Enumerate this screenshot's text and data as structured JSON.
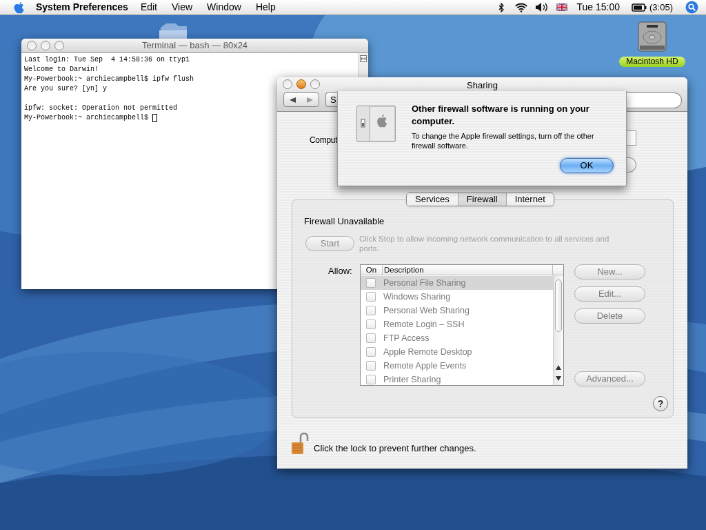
{
  "menu_bar": {
    "app": "System Preferences",
    "menus": [
      "Edit",
      "View",
      "Window",
      "Help"
    ],
    "clock": "Tue 15:00",
    "battery": "(3:05)"
  },
  "desktop": {
    "icons": [
      {
        "label": "Macintosh HD"
      }
    ]
  },
  "terminal": {
    "title": "Terminal — bash — 80x24",
    "blocks": [
      [
        "Last login: Tue Sep  4 14:58:36 on ttyp1",
        "Welcome to Darwin!",
        "My-Powerbook:~ archiecampbell$ ipfw flush",
        "Are you sure? [yn] y"
      ],
      [
        "ipfw: socket: Operation not permitted",
        "My-Powerbook:~ archiecampbell$ "
      ]
    ]
  },
  "sharing": {
    "title": "Sharing",
    "show_all": "S",
    "computer_label": "Comput",
    "tabs": [
      {
        "label": "Services",
        "selected": false
      },
      {
        "label": "Firewall",
        "selected": true
      },
      {
        "label": "Internet",
        "selected": false
      }
    ],
    "status": "Firewall Unavailable",
    "start_button": "Start",
    "start_help": "Click Stop to allow incoming network communication to all services and ports.",
    "allow_label": "Allow:",
    "columns": [
      "On",
      "Description"
    ],
    "rows": [
      {
        "description": "Personal File Sharing",
        "checked": false,
        "selected": true
      },
      {
        "description": "Windows Sharing",
        "checked": false,
        "selected": false
      },
      {
        "description": "Personal Web Sharing",
        "checked": false,
        "selected": false
      },
      {
        "description": "Remote Login – SSH",
        "checked": false,
        "selected": false
      },
      {
        "description": "FTP Access",
        "checked": false,
        "selected": false
      },
      {
        "description": "Apple Remote Desktop",
        "checked": false,
        "selected": false
      },
      {
        "description": "Remote Apple Events",
        "checked": false,
        "selected": false
      },
      {
        "description": "Printer Sharing",
        "checked": false,
        "selected": false
      }
    ],
    "side_buttons": [
      "New...",
      "Edit...",
      "Delete"
    ],
    "advanced_button": "Advanced...",
    "help": "?",
    "lock_text": "Click the lock to prevent further changes."
  },
  "sheet": {
    "title": "Other firewall software is running on your computer.",
    "message": "To change the Apple firewall settings, turn off the other firewall software.",
    "button": "OK"
  }
}
